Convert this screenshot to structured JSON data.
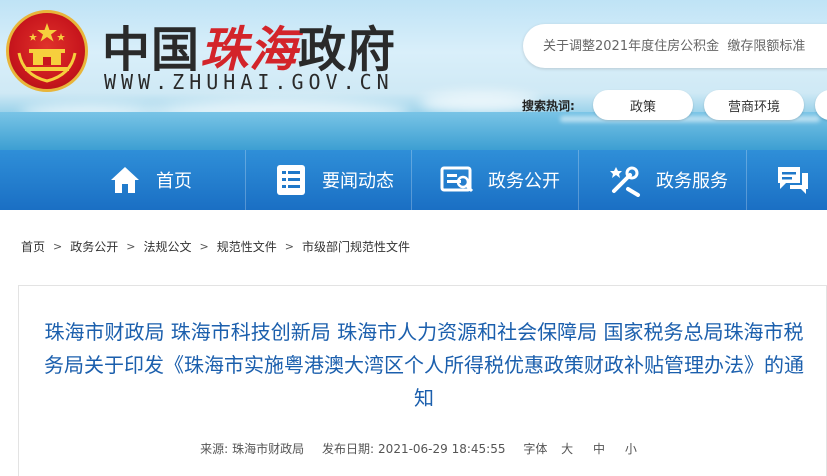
{
  "header": {
    "title_part1": "中国",
    "title_part2": "珠海",
    "title_part3": "政府",
    "domain": "WWW.ZHUHAI.GOV.CN",
    "search_placeholder": "关于调整2021年度住房公积金  缴存限额标准",
    "hot_label": "搜索热词:",
    "hot_tags": [
      "政策",
      "营商环境"
    ]
  },
  "nav": {
    "items": [
      {
        "label": "首页",
        "icon": "home-icon"
      },
      {
        "label": "要闻动态",
        "icon": "list-icon"
      },
      {
        "label": "政务公开",
        "icon": "open-info-icon"
      },
      {
        "label": "政务服务",
        "icon": "service-tools-icon"
      },
      {
        "label": "",
        "icon": "chat-icon"
      }
    ]
  },
  "breadcrumb": [
    "首页",
    "政务公开",
    "法规公文",
    "规范性文件",
    "市级部门规范性文件"
  ],
  "article": {
    "title": "珠海市财政局 珠海市科技创新局 珠海市人力资源和社会保障局 国家税务总局珠海市税务局关于印发《珠海市实施粤港澳大湾区个人所得税优惠政策财政补贴管理办法》的通知",
    "source_label": "来源:",
    "source": "珠海市财政局",
    "date_label": "发布日期:",
    "date": "2021-06-29 18:45:55",
    "font_label": "字体",
    "font_sizes": [
      "大",
      "中",
      "小"
    ]
  },
  "colors": {
    "nav_blue": "#1a6fc4",
    "title_blue": "#1b5fad",
    "brand_red": "#d3242a"
  }
}
